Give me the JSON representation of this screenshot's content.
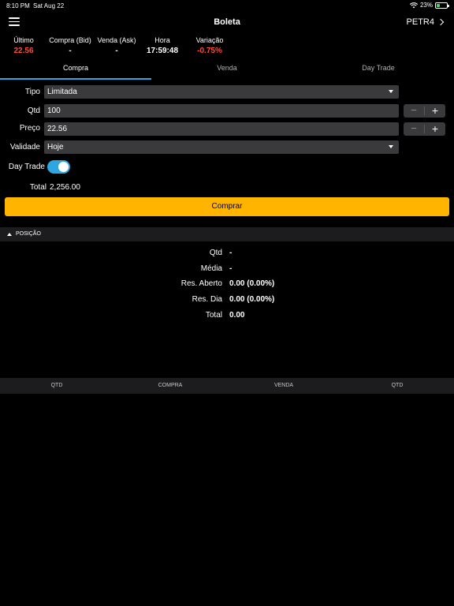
{
  "status_bar": {
    "time": "8:10 PM",
    "date": "Sat Aug 22",
    "battery": "23%"
  },
  "nav": {
    "title": "Boleta",
    "ticker": "PETR4"
  },
  "quotes": [
    {
      "label": "Último",
      "value": "22.56"
    },
    {
      "label": "Compra (Bid)",
      "value": "-"
    },
    {
      "label": "Venda (Ask)",
      "value": "-"
    },
    {
      "label": "Hora",
      "value": "17:59:48"
    },
    {
      "label": "Variação",
      "value": "-0.75%"
    }
  ],
  "tabs": [
    {
      "label": "Compra",
      "active": true
    },
    {
      "label": "Venda",
      "active": false
    },
    {
      "label": "Day Trade",
      "active": false
    }
  ],
  "order": {
    "tipo_label": "Tipo",
    "tipo_value": "Limitada",
    "qtd_label": "Qtd",
    "qtd_value": "100",
    "preco_label": "Preço",
    "preco_value": "22.56",
    "validade_label": "Validade",
    "validade_value": "Hoje",
    "daytrade_label": "Day Trade",
    "daytrade_on": true,
    "total_label": "Total",
    "total_value": "2,256.00",
    "stepper_minus": "−",
    "stepper_plus": "+"
  },
  "buy_button": "Comprar",
  "position": {
    "header": "POSIÇÃO",
    "rows": [
      {
        "label": "Qtd",
        "value": "-"
      },
      {
        "label": "Média",
        "value": "-"
      },
      {
        "label": "Res. Aberto",
        "value": "0.00 (0.00%)"
      },
      {
        "label": "Res. Dia",
        "value": "0.00 (0.00%)"
      },
      {
        "label": "Total",
        "value": "0.00"
      }
    ]
  },
  "book_columns": [
    "QTD",
    "COMPRA",
    "VENDA",
    "QTD"
  ],
  "colors": {
    "accent": "#2ea6e0",
    "buy": "#ffb400",
    "negative": "#ff4a3d",
    "field": "#3a3a3c"
  }
}
